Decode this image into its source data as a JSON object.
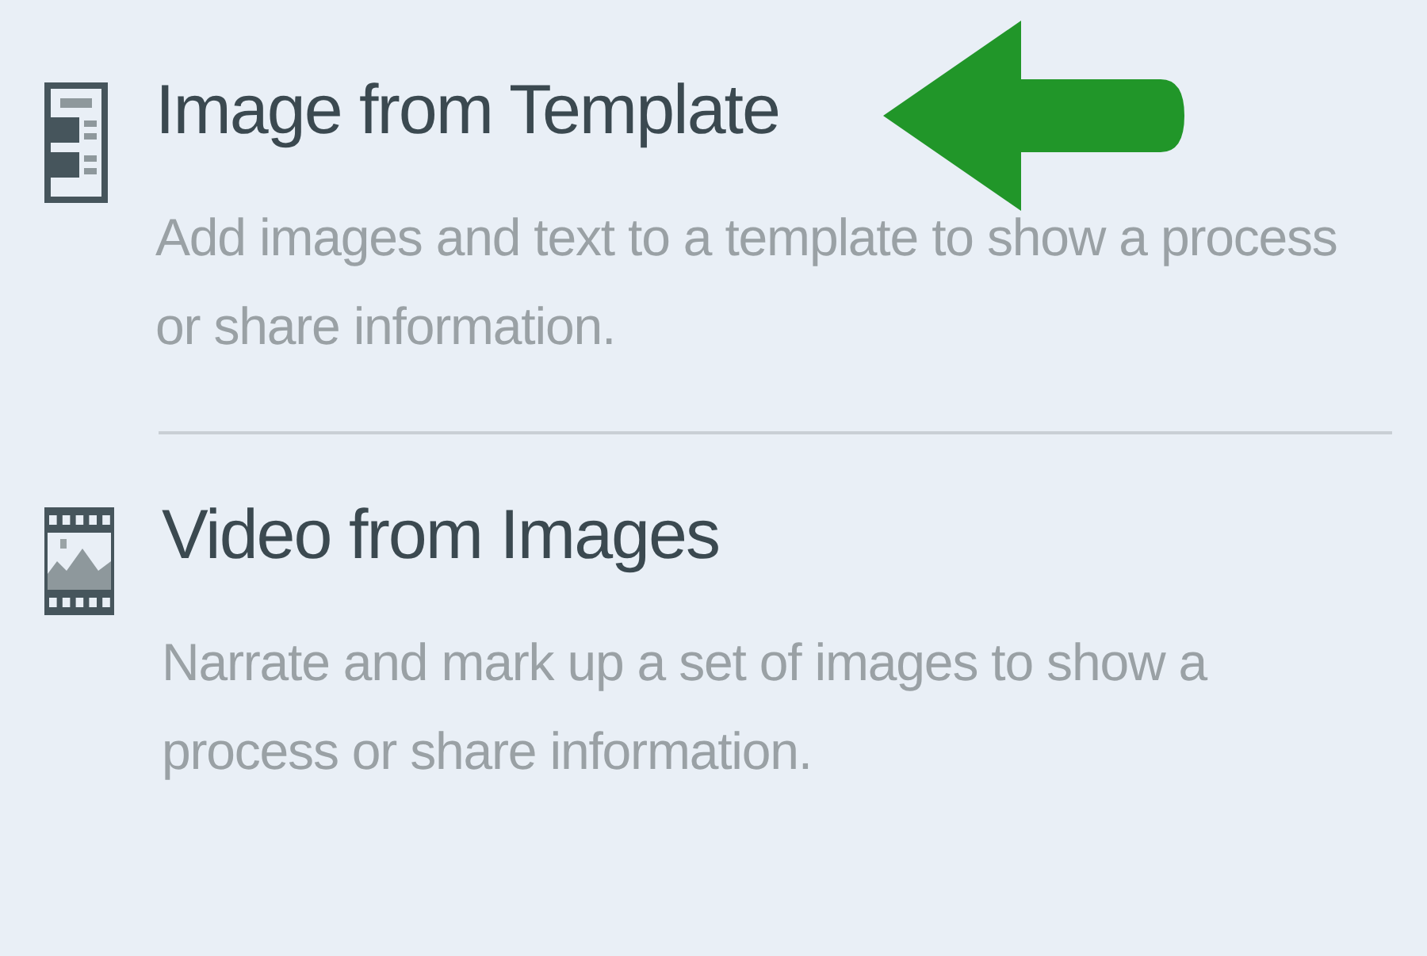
{
  "options": [
    {
      "kind": "template",
      "title": "Image from Template",
      "description": "Add images and text to a template to show a process or share information."
    },
    {
      "kind": "film",
      "title": "Video from Images",
      "description": "Narrate and mark up a set of images to show a process or share information."
    }
  ]
}
